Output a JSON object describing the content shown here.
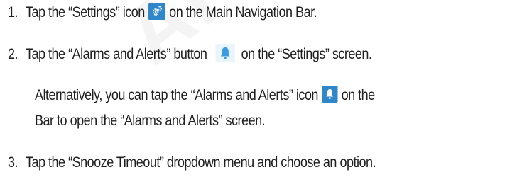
{
  "watermark": "ARTISCH",
  "steps": [
    {
      "number": "1.",
      "before": "Tap the “Settings” icon",
      "icon": "gear-icon",
      "after": "on the Main Navigation Bar."
    },
    {
      "number": "2.",
      "before": "Tap the “Alarms and Alerts” button",
      "icon": "bell-icon",
      "after": "on the “Settings” screen."
    },
    {
      "number": "",
      "before": "Alternatively, you can tap the “Alarms and Alerts” icon",
      "icon": "bell-icon",
      "after": "on the",
      "continuation": "Bar to open the “Alarms and Alerts” screen."
    },
    {
      "number": "3.",
      "before": "Tap the “Snooze Timeout” dropdown menu and choose an option."
    }
  ],
  "colors": {
    "icon_bg_dark": "#2f86c8",
    "icon_bg_light": "#eaf4fb",
    "bell": "#3a9be0",
    "text": "#1f1f1f"
  }
}
